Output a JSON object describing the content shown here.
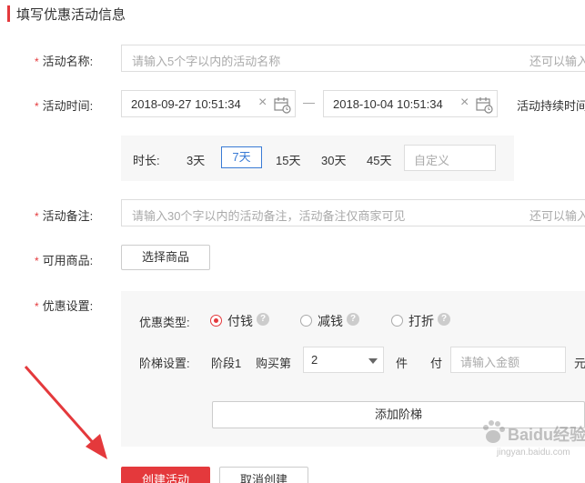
{
  "header": {
    "title": "填写优惠活动信息"
  },
  "fields": {
    "required_mark": "*",
    "name": {
      "label": "活动名称:",
      "placeholder": "请输入5个字以内的活动名称",
      "hint": "还可以输入"
    },
    "time": {
      "label": "活动时间:",
      "start": "2018-09-27 10:51:34",
      "end": "2018-10-04 10:51:34",
      "separator": "—",
      "duration_label": "活动持续时间",
      "clear_glyph": "×"
    },
    "duration": {
      "label": "时长:",
      "options": [
        "3天",
        "7天",
        "15天",
        "30天",
        "45天"
      ],
      "selected": "7天",
      "custom_placeholder": "自定义"
    },
    "remark": {
      "label": "活动备注:",
      "placeholder": "请输入30个字以内的活动备注，活动备注仅商家可见",
      "hint": "还可以输入"
    },
    "goods": {
      "label": "可用商品:",
      "button": "选择商品"
    },
    "discount": {
      "label": "优惠设置:",
      "type_label": "优惠类型:",
      "types": [
        "付钱",
        "减钱",
        "打折"
      ],
      "selected_type": "付钱",
      "help_glyph": "?",
      "tier_label": "阶梯设置:",
      "tier_stage": "阶段1",
      "tier_buy": "购买第",
      "tier_quantity": "2",
      "tier_unit": "件",
      "tier_pay": "付",
      "tier_amount_placeholder": "请输入金额",
      "tier_currency": "元",
      "add_tier_button": "添加阶梯"
    }
  },
  "actions": {
    "create": "创建活动",
    "cancel": "取消创建"
  },
  "watermark": {
    "text": "Baidu经验",
    "sub": "jingyan.baidu.com"
  },
  "colors": {
    "accent": "#e4393c",
    "selected_blue": "#3a7bd5",
    "arrow": "#e4393c"
  }
}
